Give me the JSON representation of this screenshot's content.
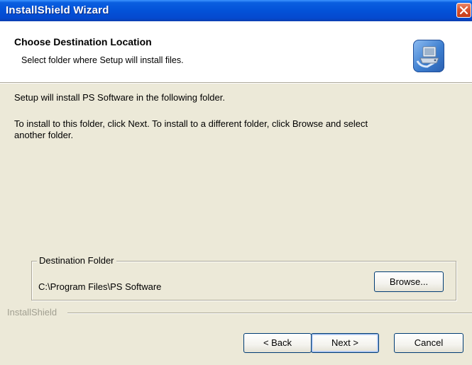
{
  "window": {
    "title": "InstallShield Wizard"
  },
  "header": {
    "title": "Choose Destination Location",
    "subtitle": "Select folder where Setup will install files."
  },
  "body": {
    "line1": "Setup will install PS Software in the following folder.",
    "line2a": "To install to this folder, click Next. To install to a different folder, click Browse and select",
    "line2b": "another folder."
  },
  "destination": {
    "group_label": "Destination Folder",
    "path": "C:\\Program Files\\PS Software",
    "browse_label": "Browse..."
  },
  "footer": {
    "brand": "InstallShield",
    "back_label": "< Back",
    "next_label": "Next >",
    "cancel_label": "Cancel"
  },
  "icons": {
    "close": "close-icon",
    "header": "setup-computer-icon"
  },
  "colors": {
    "titlebar": "#0352d8",
    "dialog_bg": "#ece9d8",
    "close_button": "#d8532f",
    "button_border": "#003c74"
  }
}
